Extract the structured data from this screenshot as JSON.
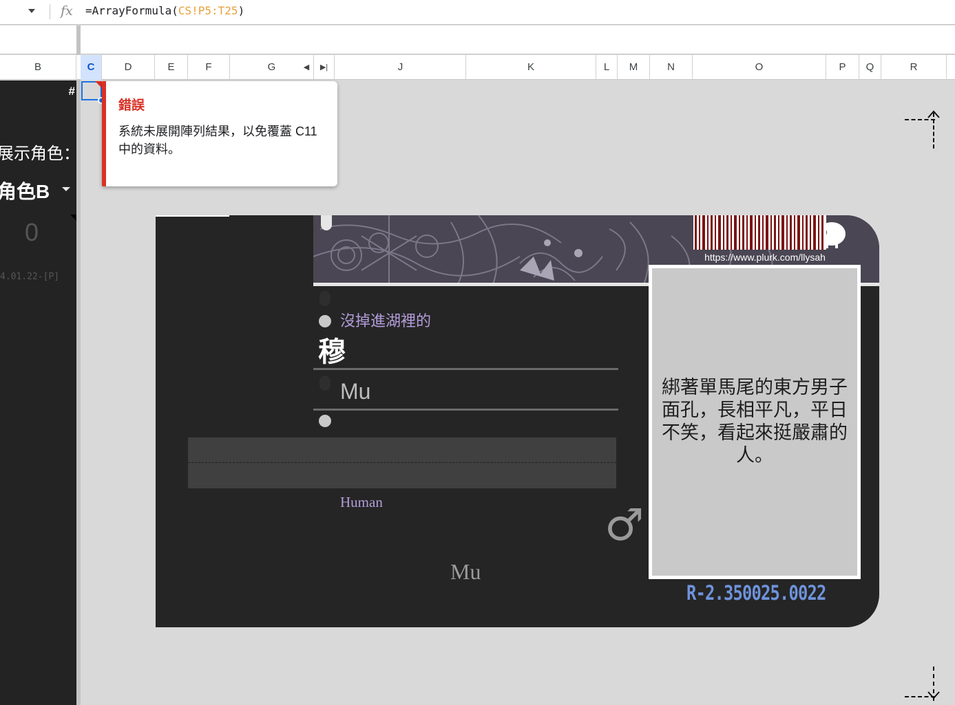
{
  "formula_bar": {
    "prefix": "=ArrayFormula(",
    "ref": "CS!P5:T25",
    "suffix": ")",
    "fx_label": "fx"
  },
  "columns": [
    "B",
    "C",
    "D",
    "E",
    "F",
    "G",
    "J",
    "K",
    "L",
    "M",
    "N",
    "O",
    "P",
    "Q",
    "R"
  ],
  "selected_column": "C",
  "sidebar": {
    "hash": "#",
    "label": "展示角色：",
    "selected_character": "角色B",
    "count": "0",
    "version": "4.01.22-[P]"
  },
  "error_popup": {
    "title": "錯誤",
    "message": "系統未展開陣列結果，以免覆蓋 C11 中的資料。"
  },
  "card": {
    "url": "https://www.plurk.com/llysah",
    "subtitle": "沒掉進湖裡的",
    "name_cn": "穆",
    "name_en": "Mu",
    "race": "Human",
    "gender_symbol": "♂",
    "nickname": "Mu",
    "description": "綁著單馬尾的東方男子面孔，長相平凡，平日不笑，看起來挺嚴肅的人。",
    "serial": "R-2.350025.0022"
  },
  "colors": {
    "error_red": "#d93025",
    "selection_blue": "#1a73e8",
    "accent_purple": "#b39ddb",
    "serial_blue": "#6f93dc",
    "card_bg": "#252525",
    "banner_bg": "#4a4653",
    "barcode_red": "#7a1414"
  }
}
